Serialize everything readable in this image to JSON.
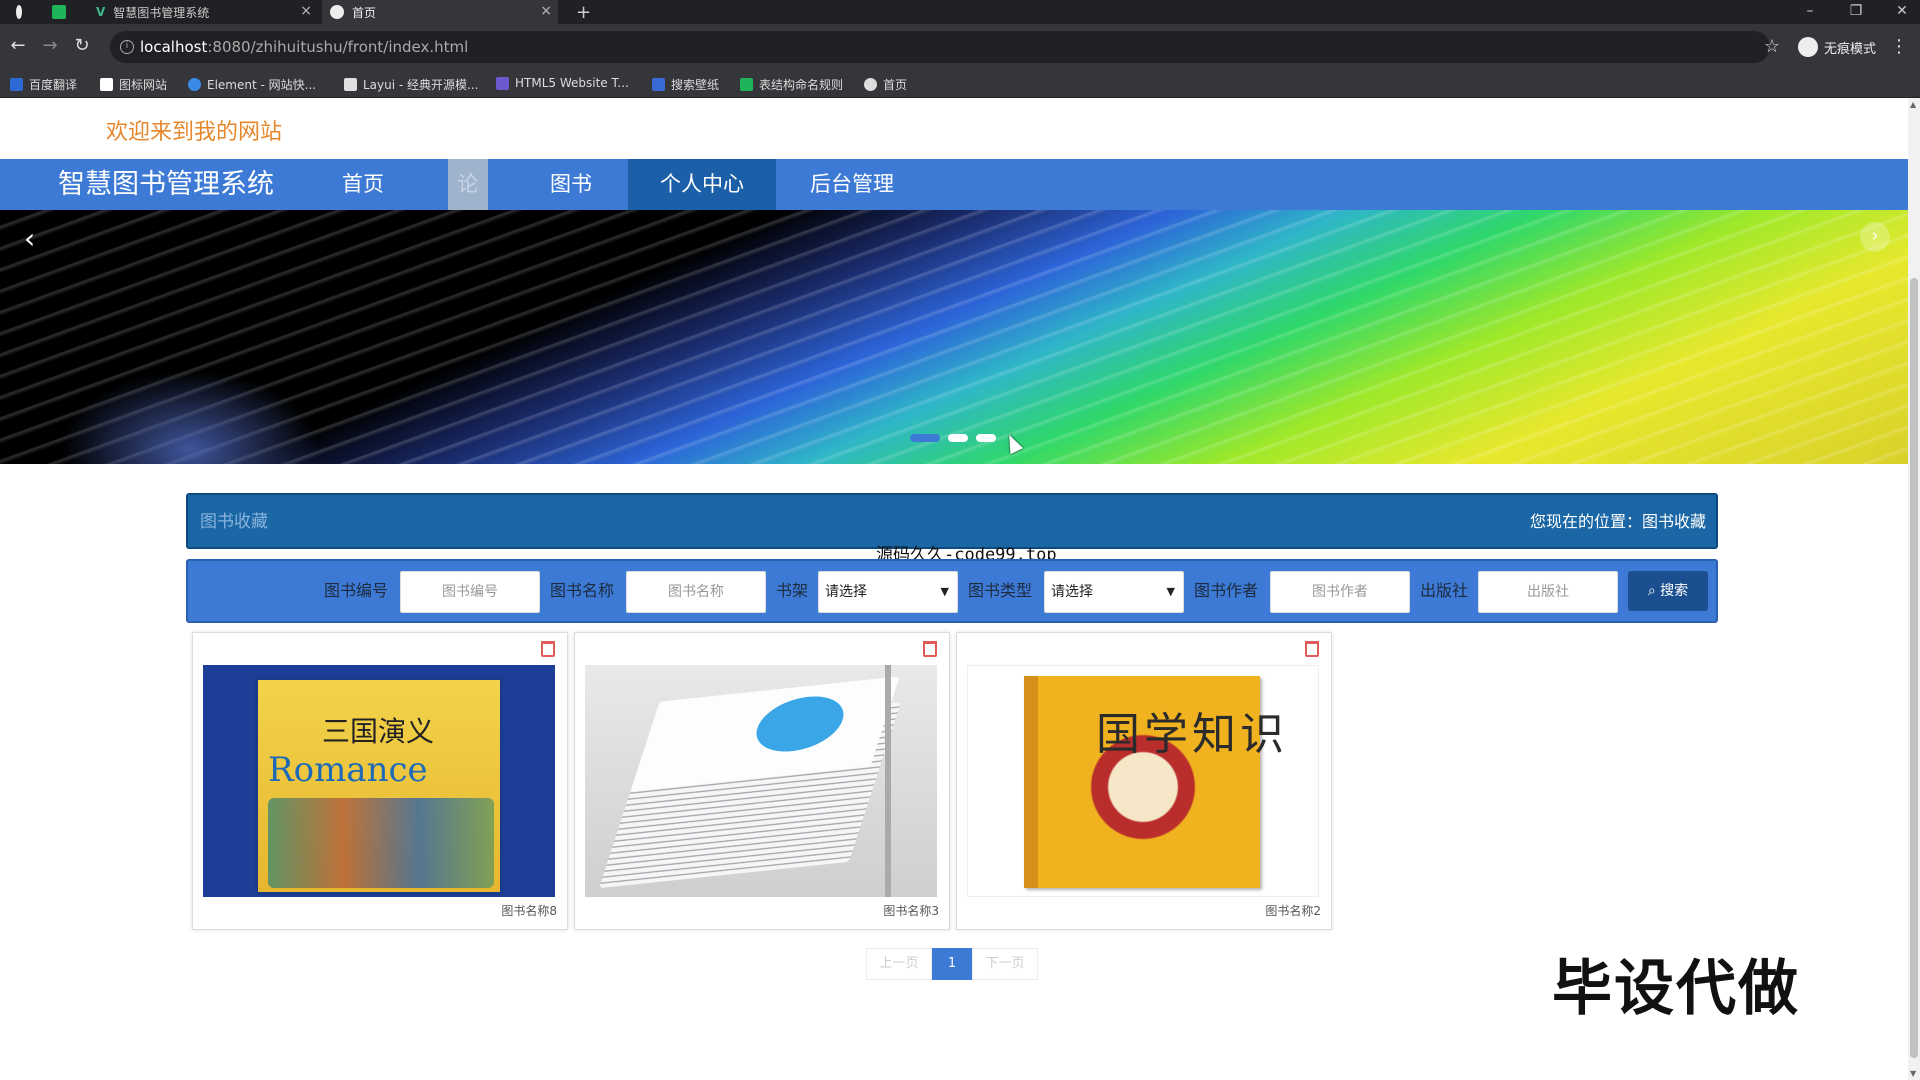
{
  "browser": {
    "tabs": [
      {
        "label": "智慧图书管理系统",
        "active": false
      },
      {
        "label": "首页",
        "active": true
      }
    ],
    "new_tab": "+",
    "url_host": "localhost",
    "url_rest": ":8080/zhihuitushu/front/index.html",
    "incognito_label": "无痕模式",
    "bookmarks": [
      {
        "label": "百度翻译",
        "color": "#2d6ad6"
      },
      {
        "label": "图标网站",
        "color": "#ffffff"
      },
      {
        "label": "Element - 网站快...",
        "color": "#3a8be8"
      },
      {
        "label": "Layui - 经典开源模...",
        "color": "#e0e0e0"
      },
      {
        "label": "HTML5 Website T...",
        "color": "#6a5acd"
      },
      {
        "label": "搜索壁纸",
        "color": "#3a6ad6"
      },
      {
        "label": "表结构命名规则",
        "color": "#1fb35a"
      },
      {
        "label": "首页",
        "color": "#dddddd"
      }
    ]
  },
  "page": {
    "welcome": "欢迎来到我的网站",
    "brand": "智慧图书管理系统",
    "nav": [
      {
        "label": "首页",
        "state": "normal"
      },
      {
        "label": "论坛",
        "state": "hover"
      },
      {
        "label": "图书",
        "state": "normal"
      },
      {
        "label": "个人中心",
        "state": "active"
      },
      {
        "label": "后台管理",
        "state": "normal"
      }
    ],
    "carousel": {
      "slide_count": 3,
      "active_index": 0
    },
    "section_title": "图书收藏",
    "breadcrumb": "您现在的位置：图书收藏",
    "watermark_top": "源码久久-code99.top",
    "search": {
      "fields": [
        {
          "label": "图书编号",
          "placeholder": "图书编号",
          "type": "input"
        },
        {
          "label": "图书名称",
          "placeholder": "图书名称",
          "type": "input"
        },
        {
          "label": "书架",
          "value": "请选择",
          "type": "select"
        },
        {
          "label": "图书类型",
          "value": "请选择",
          "type": "select"
        },
        {
          "label": "图书作者",
          "placeholder": "图书作者",
          "type": "input"
        },
        {
          "label": "出版社",
          "placeholder": "出版社",
          "type": "input"
        }
      ],
      "button": "搜索"
    },
    "books": [
      {
        "name": "图书名称8",
        "cover_title_cn": "三国演义",
        "cover_title_en": "Romance"
      },
      {
        "name": "图书名称3",
        "cover_title_cn": "",
        "cover_title_en": ""
      },
      {
        "name": "图书名称2",
        "cover_title_cn": "国学知识",
        "cover_title_en": ""
      }
    ],
    "pagination": {
      "prev": "上一页",
      "current": "1",
      "next": "下一页"
    },
    "watermark_big": "毕设代做"
  }
}
